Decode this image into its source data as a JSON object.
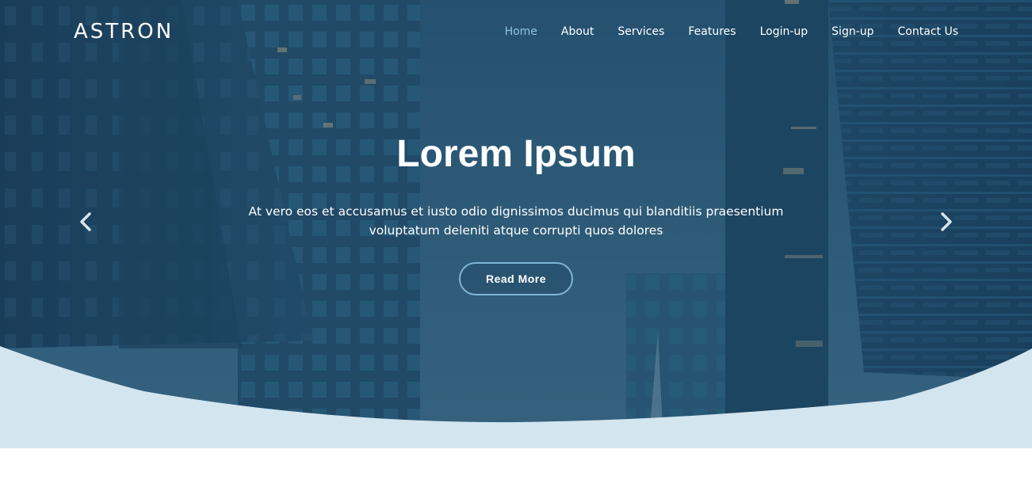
{
  "brand": {
    "name": "ASTRON"
  },
  "nav": {
    "items": [
      {
        "label": "Home",
        "active": true
      },
      {
        "label": "About"
      },
      {
        "label": "Services"
      },
      {
        "label": "Features"
      },
      {
        "label": "Login-up"
      },
      {
        "label": "Sign-up"
      },
      {
        "label": "Contact Us"
      }
    ]
  },
  "hero": {
    "title": "Lorem Ipsum",
    "description": "At vero eos et accusamus et iusto odio dignissimos ducimus qui blanditiis praesentium voluptatum deleniti atque corrupti quos dolores",
    "button_label": "Read More"
  },
  "carousel": {
    "prev_icon": "chevron-left-icon",
    "next_icon": "chevron-right-icon"
  },
  "colors": {
    "overlay": "#1f4463",
    "active_link": "#8fc3e0",
    "wave": "#d3e5ef",
    "button_border": "#7fb4d6"
  }
}
